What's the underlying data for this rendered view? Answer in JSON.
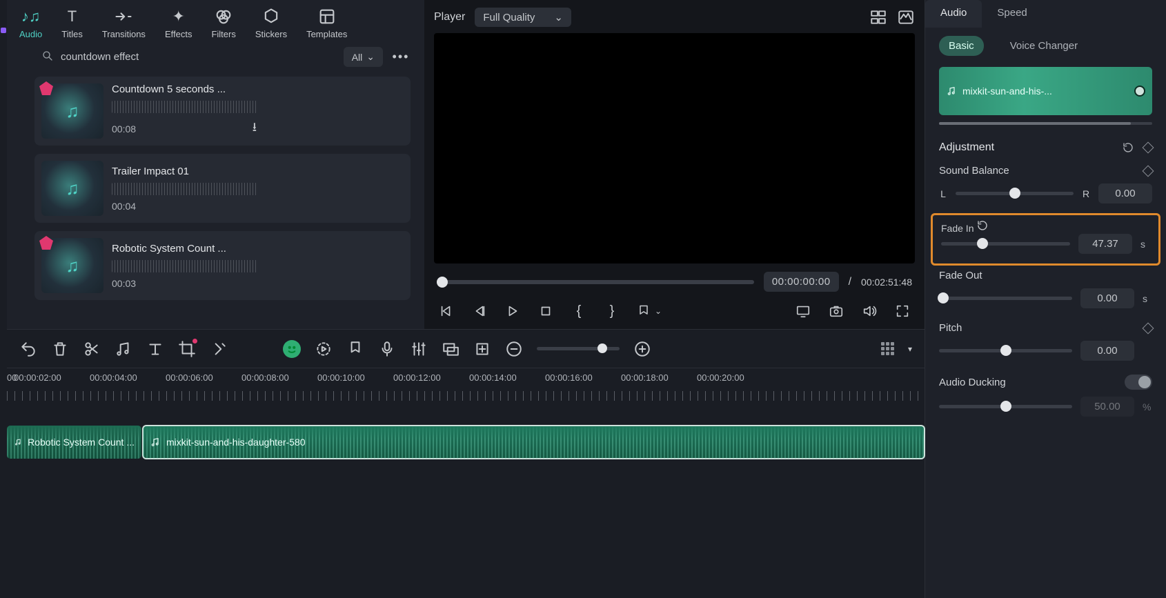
{
  "tabs": {
    "audio": "Audio",
    "titles": "Titles",
    "transitions": "Transitions",
    "effects": "Effects",
    "filters": "Filters",
    "stickers": "Stickers",
    "templates": "Templates"
  },
  "search": {
    "query": "countdown effect",
    "filter": "All"
  },
  "assets": [
    {
      "title": "Countdown 5 seconds ...",
      "dur": "00:08",
      "premium": true,
      "download": true
    },
    {
      "title": "Trailer Impact 01",
      "dur": "00:04",
      "premium": false,
      "download": false
    },
    {
      "title": "Robotic System Count ...",
      "dur": "00:03",
      "premium": true,
      "download": false
    }
  ],
  "player": {
    "label": "Player",
    "quality": "Full Quality",
    "current": "00:00:00:00",
    "sep": "/",
    "total": "00:02:51:48"
  },
  "ruler": [
    "00",
    "00:00:02:00",
    "00:00:04:00",
    "00:00:06:00",
    "00:00:08:00",
    "00:00:10:00",
    "00:00:12:00",
    "00:00:14:00",
    "00:00:16:00",
    "00:00:18:00",
    "00:00:20:00"
  ],
  "clips": {
    "a": "Robotic System Count ...",
    "b": "mixkit-sun-and-his-daughter-580"
  },
  "rpanel": {
    "tabs": {
      "audio": "Audio",
      "speed": "Speed"
    },
    "subtabs": {
      "basic": "Basic",
      "voice": "Voice Changer"
    },
    "clipname": "mixkit-sun-and-his-...",
    "adjustment": "Adjustment",
    "sound_balance": {
      "label": "Sound Balance",
      "l": "L",
      "r": "R",
      "val": "0.00"
    },
    "fade_in": {
      "label": "Fade In",
      "val": "47.37",
      "unit": "s"
    },
    "fade_out": {
      "label": "Fade Out",
      "val": "0.00",
      "unit": "s"
    },
    "pitch": {
      "label": "Pitch",
      "val": "0.00"
    },
    "ducking": {
      "label": "Audio Ducking",
      "val": "50.00",
      "unit": "%"
    }
  }
}
